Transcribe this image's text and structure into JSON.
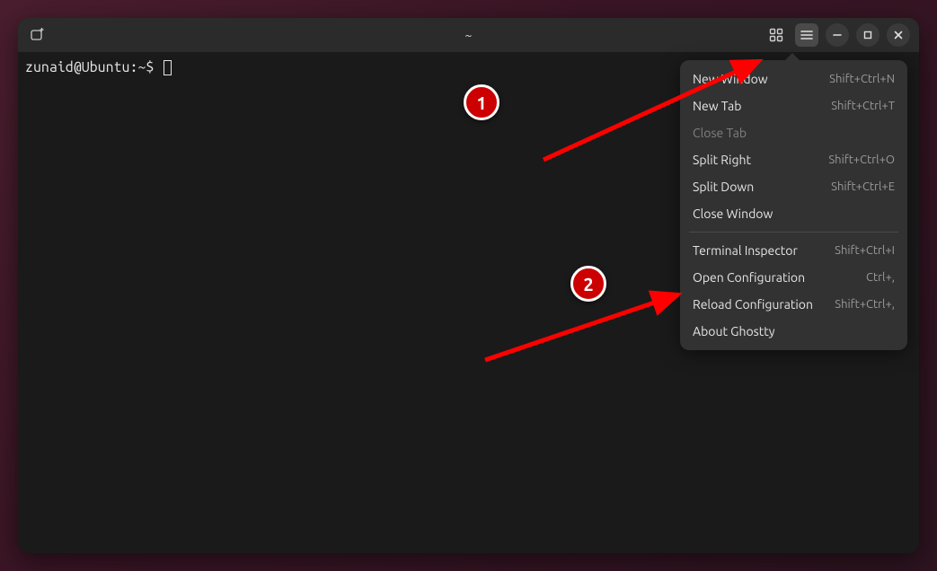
{
  "window": {
    "title": "~"
  },
  "terminal": {
    "prompt": "zunaid@Ubuntu:~$"
  },
  "menu": {
    "section1": [
      {
        "label": "New Window",
        "shortcut": "Shift+Ctrl+N",
        "enabled": true
      },
      {
        "label": "New Tab",
        "shortcut": "Shift+Ctrl+T",
        "enabled": true
      },
      {
        "label": "Close Tab",
        "shortcut": "",
        "enabled": false
      },
      {
        "label": "Split Right",
        "shortcut": "Shift+Ctrl+O",
        "enabled": true
      },
      {
        "label": "Split Down",
        "shortcut": "Shift+Ctrl+E",
        "enabled": true
      },
      {
        "label": "Close Window",
        "shortcut": "",
        "enabled": true
      }
    ],
    "section2": [
      {
        "label": "Terminal Inspector",
        "shortcut": "Shift+Ctrl+I",
        "enabled": true
      },
      {
        "label": "Open Configuration",
        "shortcut": "Ctrl+,",
        "enabled": true
      },
      {
        "label": "Reload Configuration",
        "shortcut": "Shift+Ctrl+,",
        "enabled": true
      },
      {
        "label": "About Ghostty",
        "shortcut": "",
        "enabled": true
      }
    ]
  },
  "callouts": {
    "one": "1",
    "two": "2"
  }
}
